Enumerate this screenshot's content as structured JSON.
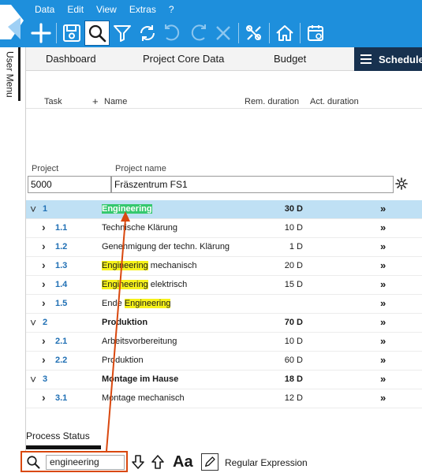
{
  "menu": [
    "Data",
    "Edit",
    "View",
    "Extras",
    "?"
  ],
  "side": {
    "user_menu": "User Menu"
  },
  "tabs": {
    "dashboard": "Dashboard",
    "core": "Project Core Data",
    "budget": "Budget",
    "schedule": "Schedule",
    "close": "×"
  },
  "columns": {
    "task": "Task",
    "add": "+",
    "name": "Name",
    "rem": "Rem. duration",
    "act": "Act. duration"
  },
  "project": {
    "label": "Project",
    "name_label": "Project name",
    "number": "5000",
    "name": "Fräszentrum FS1"
  },
  "rows": [
    {
      "num": "1",
      "name_parts": [
        {
          "t": "Engineering",
          "cls": "hlcur"
        }
      ],
      "dur": "30 D",
      "bold": true,
      "expanded": true,
      "selected": true
    },
    {
      "num": "1.1",
      "name_parts": [
        {
          "t": "Technische Klärung",
          "cls": ""
        }
      ],
      "dur": "10 D"
    },
    {
      "num": "1.2",
      "name_parts": [
        {
          "t": "Genehmigung der techn. Klärung",
          "cls": ""
        }
      ],
      "dur": "1 D"
    },
    {
      "num": "1.3",
      "name_parts": [
        {
          "t": "Engineering",
          "cls": "hl"
        },
        {
          "t": " mechanisch",
          "cls": ""
        }
      ],
      "dur": "20 D"
    },
    {
      "num": "1.4",
      "name_parts": [
        {
          "t": "Engineering",
          "cls": "hl"
        },
        {
          "t": " elektrisch",
          "cls": ""
        }
      ],
      "dur": "15 D"
    },
    {
      "num": "1.5",
      "name_parts": [
        {
          "t": "Ende ",
          "cls": ""
        },
        {
          "t": "Engineering",
          "cls": "hl"
        }
      ],
      "dur": ""
    },
    {
      "num": "2",
      "name_parts": [
        {
          "t": "Produktion",
          "cls": ""
        }
      ],
      "dur": "70 D",
      "bold": true,
      "expanded": true
    },
    {
      "num": "2.1",
      "name_parts": [
        {
          "t": "Arbeitsvorbereitung",
          "cls": ""
        }
      ],
      "dur": "10 D"
    },
    {
      "num": "2.2",
      "name_parts": [
        {
          "t": "Produktion",
          "cls": ""
        }
      ],
      "dur": "60 D"
    },
    {
      "num": "3",
      "name_parts": [
        {
          "t": "Montage im Hause",
          "cls": ""
        }
      ],
      "dur": "18 D",
      "bold": true,
      "expanded": true
    },
    {
      "num": "3.1",
      "name_parts": [
        {
          "t": "Montage mechanisch",
          "cls": ""
        }
      ],
      "dur": "12 D"
    }
  ],
  "more_glyph": "»",
  "bottom": {
    "process_status": "Process Status",
    "search_value": "engineering",
    "case_label": "Aa",
    "regex_label": "Regular Expression"
  },
  "colors": {
    "accent": "#1e8fdc",
    "active_tab": "#17314f",
    "highlight": "#f6f21a",
    "current_match": "#35c86e",
    "annotation": "#d9480f"
  }
}
